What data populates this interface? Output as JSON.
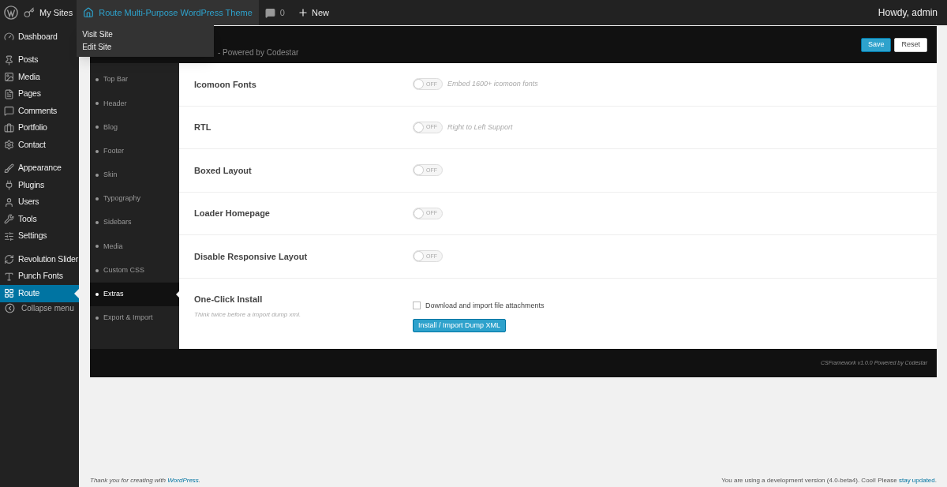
{
  "admin_bar": {
    "items": [
      {
        "kind": "logo"
      },
      {
        "kind": "sites",
        "label": "My Sites"
      },
      {
        "kind": "site",
        "label": "Route Multi-Purpose WordPress Theme",
        "expanded": true
      },
      {
        "kind": "comments",
        "label": "0"
      },
      {
        "kind": "new",
        "label": "New"
      }
    ],
    "greeting": "Howdy, admin",
    "dropdown": [
      "Visit Site",
      "Edit Site"
    ]
  },
  "sidebar": {
    "groups": [
      {
        "items": [
          {
            "label": "Dashboard",
            "selected": false
          }
        ]
      },
      {
        "items": [
          {
            "label": "Posts",
            "selected": false
          },
          {
            "label": "Media",
            "selected": false
          },
          {
            "label": "Pages",
            "selected": false
          },
          {
            "label": "Comments",
            "selected": false
          },
          {
            "label": "Portfolio",
            "selected": false
          },
          {
            "label": "Contact",
            "selected": false
          }
        ]
      },
      {
        "items": [
          {
            "label": "Appearance",
            "selected": false
          },
          {
            "label": "Plugins",
            "selected": false
          },
          {
            "label": "Users",
            "selected": false
          },
          {
            "label": "Tools",
            "selected": false
          },
          {
            "label": "Settings",
            "selected": false
          }
        ]
      },
      {
        "items": [
          {
            "label": "Revolution Slider",
            "selected": false
          },
          {
            "label": "Punch Fonts",
            "selected": false
          },
          {
            "label": "Route",
            "selected": true
          }
        ]
      }
    ],
    "collapse": "Collapse menu"
  },
  "framework": {
    "subtitle": "- Powered by Codestar",
    "buttons": [
      "Save",
      "Reset"
    ],
    "nav": [
      {
        "label": "Top Bar",
        "selected": false
      },
      {
        "label": "Header",
        "selected": false
      },
      {
        "label": "Blog",
        "selected": false
      },
      {
        "label": "Footer",
        "selected": false
      },
      {
        "label": "Skin",
        "selected": false
      },
      {
        "label": "Typography",
        "selected": false
      },
      {
        "label": "Sidebars",
        "selected": false
      },
      {
        "label": "Media",
        "selected": false
      },
      {
        "label": "Custom CSS",
        "selected": false
      },
      {
        "label": "Extras",
        "selected": true
      },
      {
        "label": "Export & Import",
        "selected": false
      }
    ],
    "fields": [
      {
        "kind": "toggle",
        "label": "Icomoon Fonts",
        "on": false,
        "switch_text": "OFF",
        "help": "Embed 1600+ icomoon fonts"
      },
      {
        "kind": "toggle",
        "label": "RTL",
        "on": false,
        "switch_text": "OFF",
        "help": "Right to Left Support"
      },
      {
        "kind": "toggle",
        "label": "Boxed Layout",
        "on": false,
        "switch_text": "OFF"
      },
      {
        "kind": "toggle",
        "label": "Loader Homepage",
        "on": false,
        "switch_text": "OFF"
      },
      {
        "kind": "toggle",
        "label": "Disable Responsive Layout",
        "on": false,
        "switch_text": "OFF"
      },
      {
        "kind": "install",
        "label": "One-Click Install",
        "description": "Think twice before a import dump xml.",
        "checkbox": {
          "label": "Download and import file attachments",
          "checked": false
        },
        "button": "Install / Import Dump XML"
      }
    ],
    "footer": "CSFramework v1.0.0 Powered by Codestar"
  },
  "page_footer": {
    "left": "Thank you for creating with ",
    "left_link": "WordPress",
    "left_end": ".",
    "right": "You are using a development version (4.0-beta4). Cool! Please ",
    "right_link": "stay updated",
    "right_end": "."
  }
}
